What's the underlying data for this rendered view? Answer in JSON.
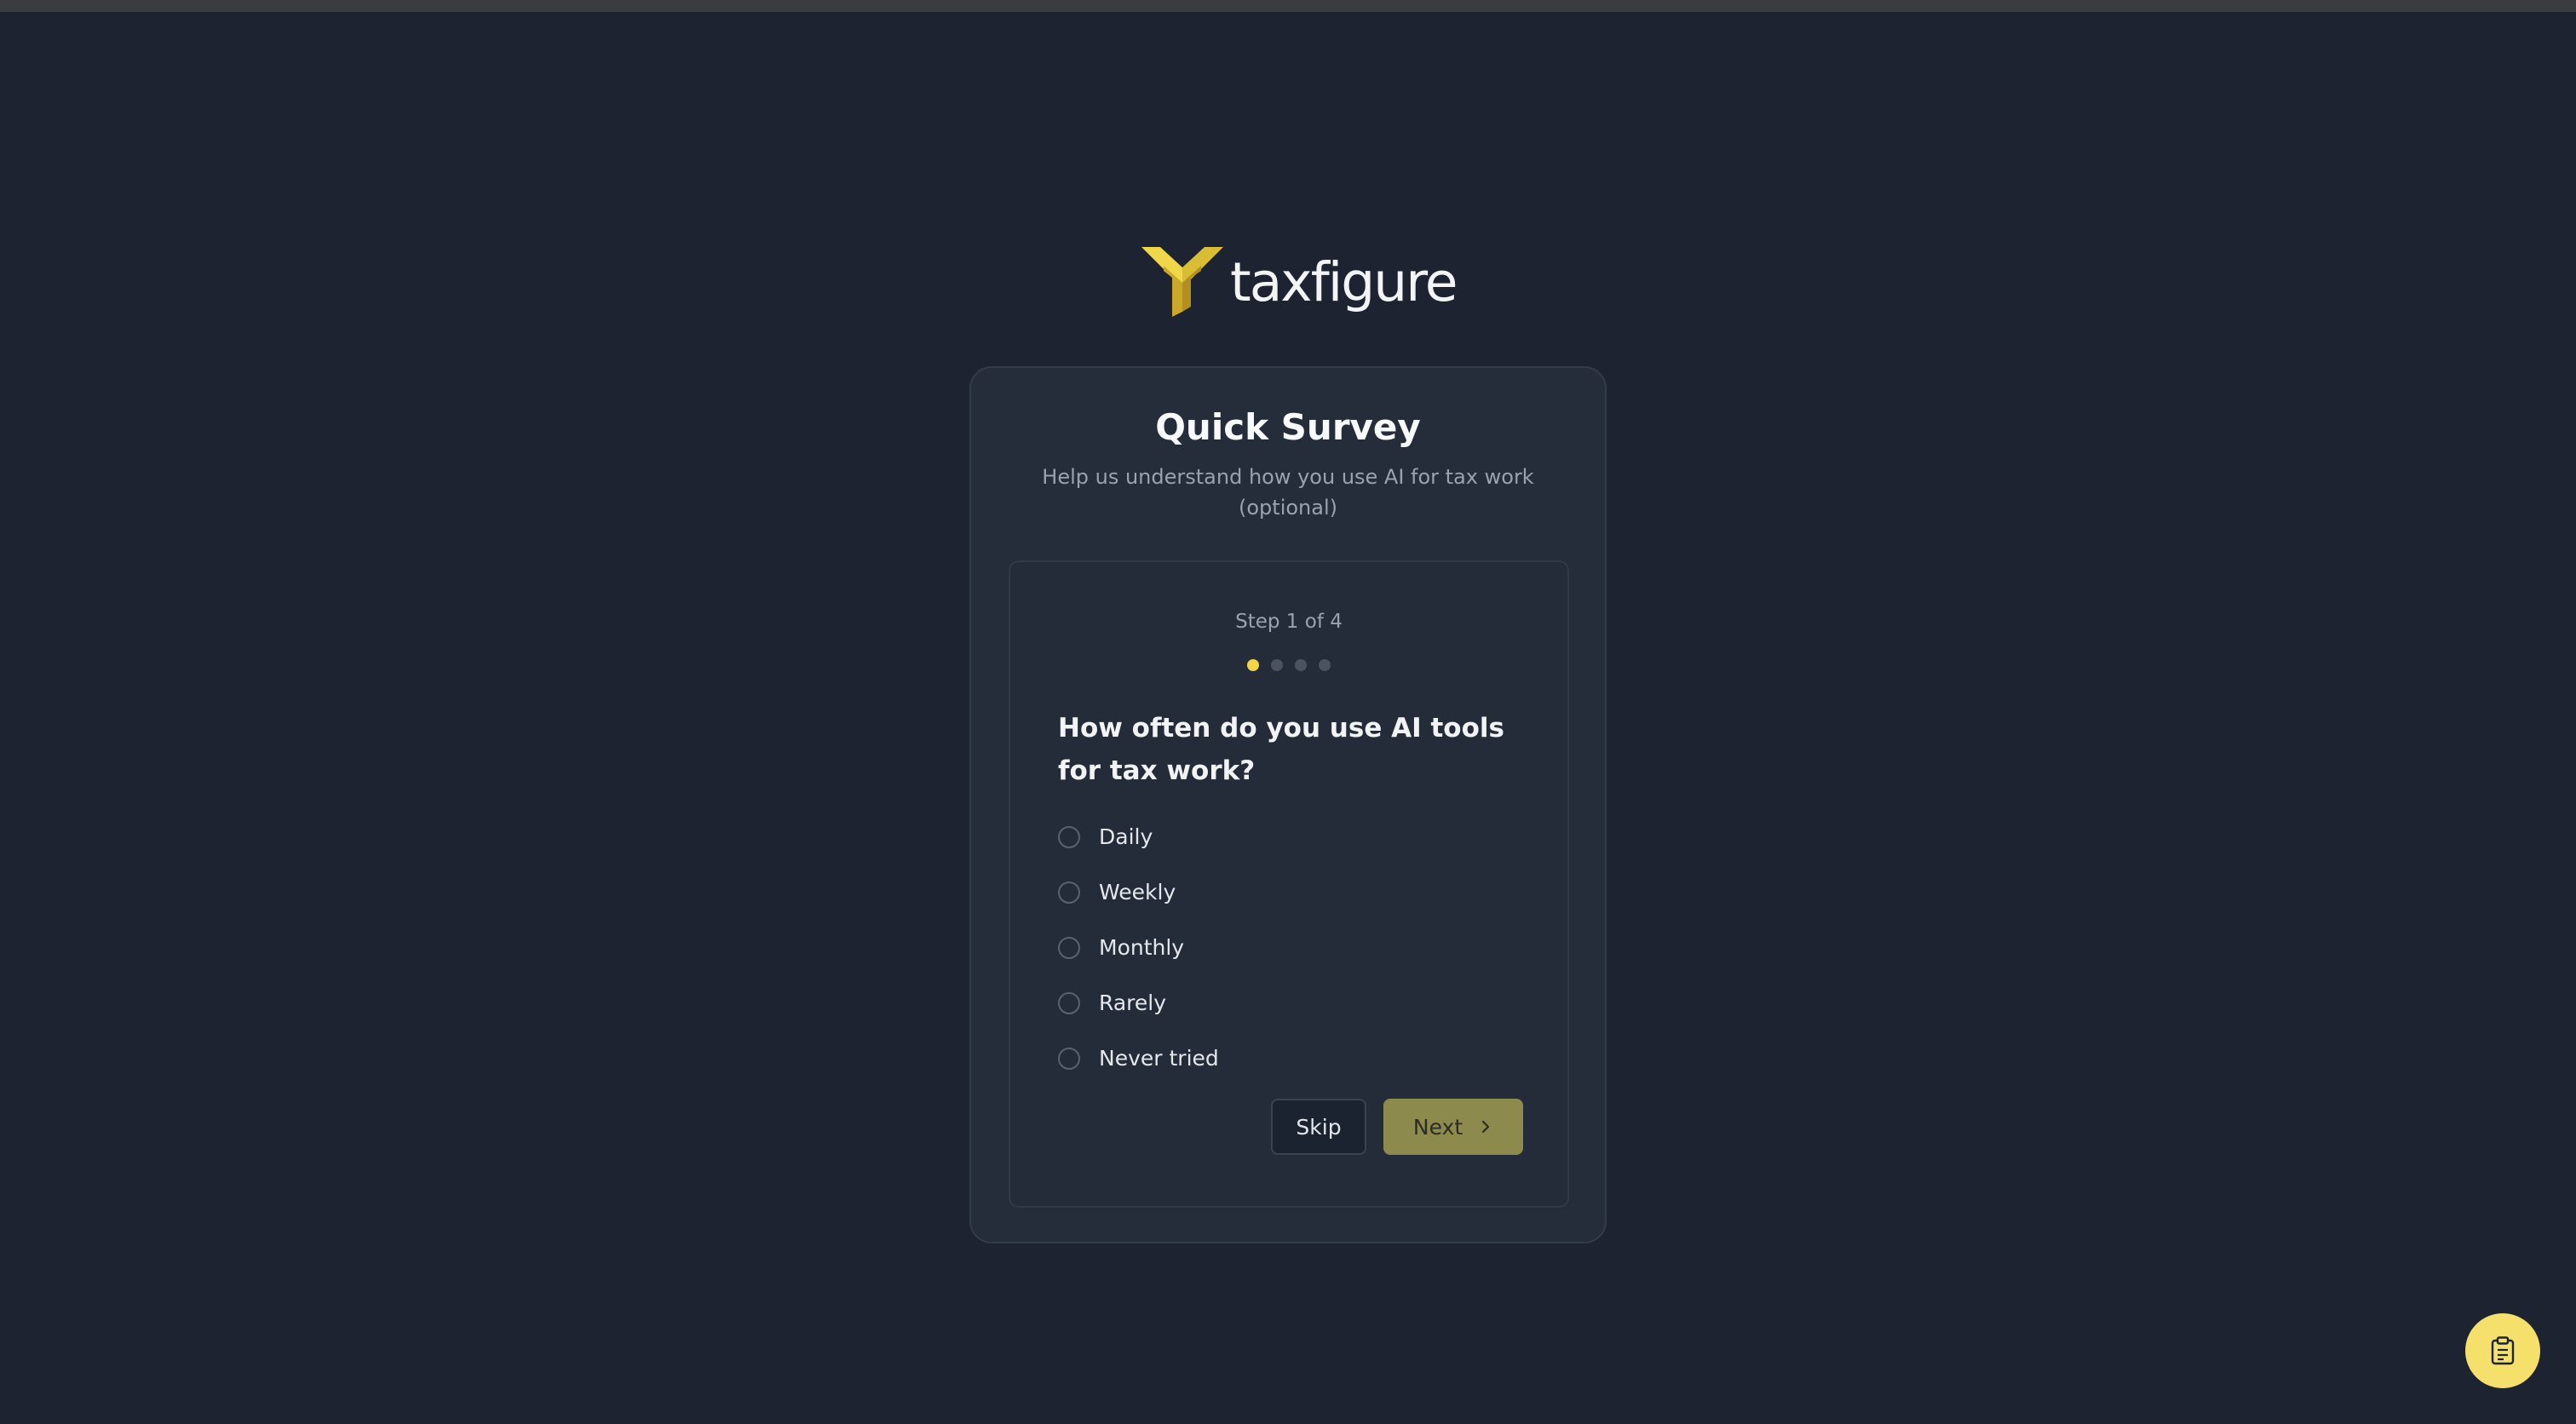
{
  "brand": {
    "name": "taxfigure",
    "accent_color": "#f0d74a"
  },
  "survey": {
    "title": "Quick Survey",
    "subtitle": "Help us understand how you use AI for tax work (optional)",
    "step_label": "Step 1 of 4",
    "current_step": 1,
    "total_steps": 4,
    "question": "How often do you use AI tools for tax work?",
    "options": [
      {
        "label": "Daily",
        "selected": false
      },
      {
        "label": "Weekly",
        "selected": false
      },
      {
        "label": "Monthly",
        "selected": false
      },
      {
        "label": "Rarely",
        "selected": false
      },
      {
        "label": "Never tried",
        "selected": false
      }
    ],
    "skip_label": "Skip",
    "next_label": "Next"
  },
  "icons": {
    "logo": "taxfigure-logo-icon",
    "next": "chevron-right-icon",
    "fab": "clipboard-icon"
  }
}
